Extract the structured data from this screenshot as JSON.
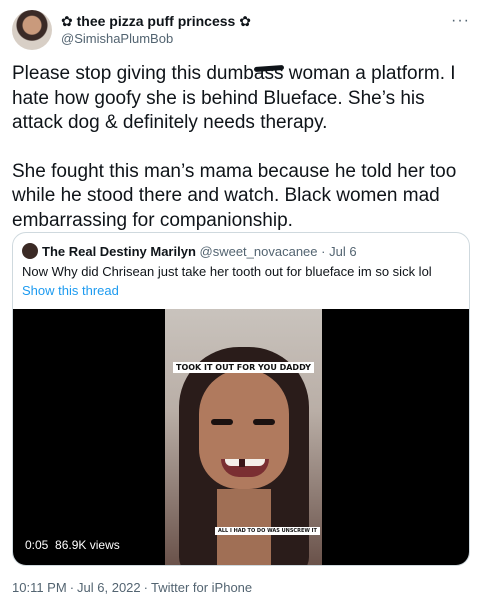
{
  "author": {
    "display_name": "✿ thee pizza puff princess ✿",
    "handle": "@SimishaPlumBob"
  },
  "more_label": "···",
  "tweet": {
    "paragraph1_before": "Please stop giving this dumb",
    "paragraph1_scribbled": "ass",
    "paragraph1_after": " woman a platform. I hate how goofy she is behind Blueface. She’s his attack dog & definitely needs therapy.",
    "paragraph2": "She fought this man’s mama because he told her too while he stood there and watch. Black women mad embarrassing for companionship."
  },
  "quoted_tweet": {
    "name": "The Real Destiny Marilyn",
    "handle": "@sweet_novacanee",
    "separator": "·",
    "date": "Jul 6",
    "text": "Now Why did Chrisean just take her tooth out for blueface im so sick lol",
    "show_thread": "Show this thread",
    "video": {
      "caption_top": "TOOK IT OUT FOR YOU DADDY",
      "caption_bottom": "ALL I HAD TO DO WAS UNSCREW IT",
      "time": "0:05",
      "views": "86.9K views"
    }
  },
  "footer": {
    "time": "10:11 PM",
    "separator": "·",
    "date": "Jul 6, 2022",
    "source": "Twitter for iPhone"
  },
  "colors": {
    "text": "#0f1419",
    "secondary": "#536471",
    "link": "#1d9bf0",
    "border": "#cfd9de"
  }
}
